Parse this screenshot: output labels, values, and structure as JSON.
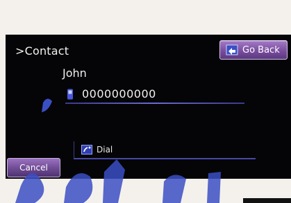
{
  "header": {
    "title": ">Contact",
    "go_back_label": "Go Back"
  },
  "contact": {
    "name": "John",
    "phone": "0000000000"
  },
  "actions": {
    "dial_label": "Dial",
    "cancel_label": "Cancel"
  },
  "icons": {
    "go_back": "go-back-icon",
    "phone": "mobile-phone-icon",
    "dial": "dial-icon"
  },
  "colors": {
    "screen_bg": "#050507",
    "button_purple": "#7a4e9e",
    "underline_blue": "#5050b8",
    "watermark_blue": "#3b4fc4"
  }
}
